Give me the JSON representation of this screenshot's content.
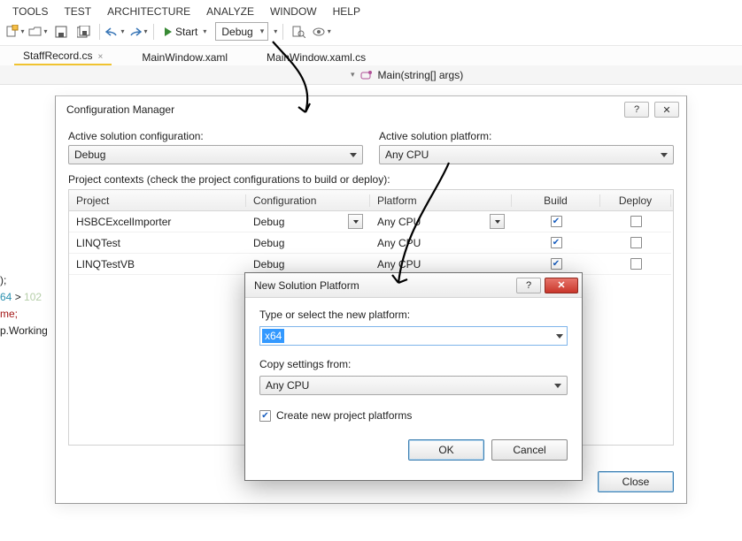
{
  "menu": {
    "items": [
      "TOOLS",
      "TEST",
      "ARCHITECTURE",
      "ANALYZE",
      "WINDOW",
      "HELP"
    ]
  },
  "toolbar": {
    "start_label": "Start",
    "config_combo": "Debug"
  },
  "tabs": {
    "items": [
      {
        "label": "StaffRecord.cs",
        "active": true
      },
      {
        "label": "MainWindow.xaml",
        "active": false
      },
      {
        "label": "MainWindow.xaml.cs",
        "active": false
      }
    ]
  },
  "crumb": {
    "member": "Main(string[] args)"
  },
  "code_peek": {
    "l1": ");",
    "l2_a": "64",
    "l2_b": " > ",
    "l2_c": "102",
    "l3": "me;",
    "l4": "p.Working"
  },
  "config_mgr": {
    "title": "Configuration Manager",
    "labels": {
      "active_cfg": "Active solution configuration:",
      "active_plat": "Active solution platform:",
      "contexts": "Project contexts (check the project configurations to build or deploy):"
    },
    "active_cfg_value": "Debug",
    "active_plat_value": "Any CPU",
    "columns": [
      "Project",
      "Configuration",
      "Platform",
      "Build",
      "Deploy"
    ],
    "rows": [
      {
        "project": "HSBCExcelImporter",
        "config": "Debug",
        "platform": "Any CPU",
        "build": true,
        "deploy": false,
        "config_dd": true,
        "plat_dd": true
      },
      {
        "project": "LINQTest",
        "config": "Debug",
        "platform": "Any CPU",
        "build": true,
        "deploy": false,
        "config_dd": false,
        "plat_dd": false
      },
      {
        "project": "LINQTestVB",
        "config": "Debug",
        "platform": "Any CPU",
        "build": true,
        "deploy": false,
        "config_dd": false,
        "plat_dd": false
      }
    ],
    "close_btn": "Close"
  },
  "new_plat": {
    "title": "New Solution Platform",
    "type_label": "Type or select the new platform:",
    "type_value": "x64",
    "copy_label": "Copy settings from:",
    "copy_value": "Any CPU",
    "create_chk_label": "Create new project platforms",
    "create_chk": true,
    "ok": "OK",
    "cancel": "Cancel"
  }
}
